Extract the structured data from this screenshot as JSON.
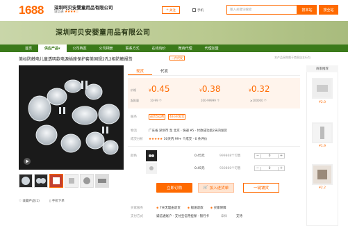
{
  "header": {
    "logo": "1688",
    "shop_name": "深圳呵贝安婴童用品有限公司",
    "shop_sub": "诚信通",
    "follow": "关注",
    "mobile": "手机",
    "search_placeholder": "输入关键词搜索",
    "search_all": "搜本站",
    "search_shop": "搜全站"
  },
  "banner": {
    "title": "深圳呵贝安婴童用品有限公司"
  },
  "nav": {
    "items": [
      "首页",
      "供应产品",
      "公司档案",
      "公司相册",
      "联系方式",
      "在线询价",
      "微商代理",
      "代理加盟"
    ]
  },
  "product": {
    "title": "美标防触电儿童透明款电源插座保护套美国规2孔2相防触报货",
    "badge": "一件代发",
    "right_note": "本产品采购属于商家自主行为"
  },
  "tabs": {
    "items": [
      "现货",
      "代发"
    ]
  },
  "prices": {
    "label_price": "价格",
    "label_qty": "起批量",
    "tiers": [
      {
        "price": "0.45",
        "qty": "10-99 个"
      },
      {
        "price": "0.38",
        "qty": "100-99999 个"
      },
      {
        "price": "0.32",
        "qty": "≥100000 个"
      }
    ],
    "currency": "¥"
  },
  "info": {
    "service_label": "服务",
    "service_tag1": "退货包运费",
    "service_tag2": "48小时发货",
    "ship_label": "物流",
    "ship_text": "广东省 深圳市 至 北京 · 快递 ¥5 · 付款成功后2天内发货",
    "rating_label": "成交分析",
    "rating_text": "30天内 99+ 个成交 · 6 条评价"
  },
  "sku": {
    "label": "颜色",
    "rows": [
      {
        "price": "0.45元",
        "stock": "999868个可售",
        "qty": "0"
      },
      {
        "price": "0.45元",
        "stock": "930860个可售",
        "qty": "0"
      }
    ]
  },
  "actions": {
    "order": "立即订购",
    "cart": "加入进货单",
    "oneclick": "一键铺货"
  },
  "services_footer": {
    "label1": "买家服务",
    "items": [
      "7天无理由退货",
      "极速退款",
      "买家保障"
    ],
    "label2": "支付方式",
    "pay": "诚信通账户 · 支付宝信用担保 · 银行卡",
    "label3": "拿样",
    "pay2": "支持"
  },
  "bottom_left": {
    "share": "收藏产品(1)",
    "mobile_order": "手机下单"
  },
  "side": {
    "title": "商家推荐",
    "items": [
      {
        "price": "¥2.0"
      },
      {
        "price": "¥1.9"
      },
      {
        "price": "¥2.2"
      }
    ]
  },
  "colors": {
    "accent": "#ff6a00",
    "nav": "#3b7a1a"
  }
}
